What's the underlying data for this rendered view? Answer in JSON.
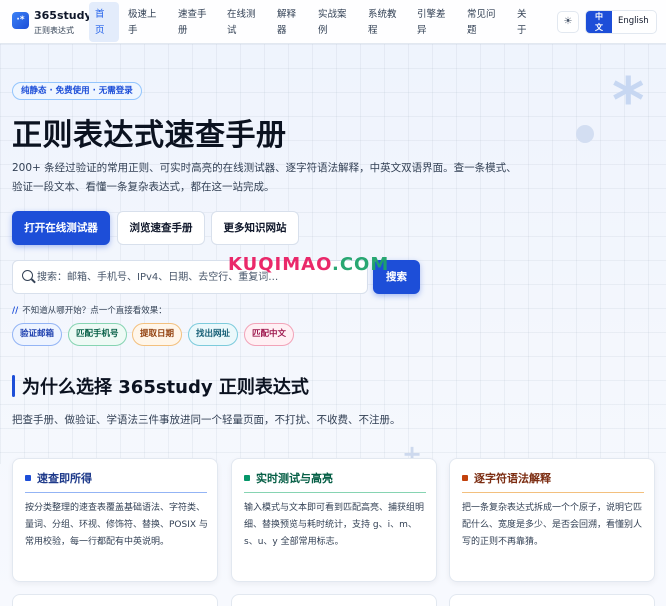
{
  "brand": {
    "name": "365study",
    "subtitle": "正则表达式",
    "logo_glyph": "·*"
  },
  "nav": {
    "items": [
      "首页",
      "极速上手",
      "速查手册",
      "在线测试",
      "解释器",
      "实战案例",
      "系统教程",
      "引擎差异",
      "常见问题",
      "关于"
    ],
    "active_index": 0
  },
  "theme_toggle": {
    "icon": "sun-icon",
    "glyph": "☀"
  },
  "lang": {
    "zh": "中文",
    "en": "English",
    "active": "zh"
  },
  "hero": {
    "badge": "纯静态 · 免费使用 · 无需登录",
    "title": "正则表达式速查手册",
    "description": "200+ 条经过验证的常用正则、可实时高亮的在线测试器、逐字符语法解释，中英文双语界面。查一条模式、验证一段文本、看懂一条复杂表达式，都在这一站完成。",
    "primary_button": "打开在线测试器",
    "secondary_button": "浏览速查手册",
    "tertiary_button": "更多知识网站"
  },
  "search": {
    "placeholder": "搜索：邮箱、手机号、IPv4、日期、去空行、重复词…",
    "button": "搜索"
  },
  "hint": {
    "prefix": "//",
    "text": "不知道从哪开始？点一个直接看效果："
  },
  "quick_chips": [
    "验证邮箱",
    "匹配手机号",
    "提取日期",
    "找出网址",
    "匹配中文"
  ],
  "watermark": {
    "left": "KUQIMAO",
    "dot": ".",
    "right": "COM"
  },
  "why": {
    "title": "为什么选择 365study 正则表达式",
    "description": "把查手册、做验证、学语法三件事放进同一个轻量页面，不打扰、不收费、不注册。"
  },
  "features": [
    {
      "title": "速查即所得",
      "text": "按分类整理的速查表覆盖基础语法、字符类、量词、分组、环视、修饰符、替换、POSIX 与常用校验，每一行都配有中英说明。"
    },
    {
      "title": "实时测试与高亮",
      "text": "输入模式与文本即可看到匹配高亮、捕获组明细、替换预览与耗时统计，支持 g、i、m、s、u、y 全部常用标志。"
    },
    {
      "title": "逐字符语法解释",
      "text": "把一条复杂表达式拆成一个个原子，说明它匹配什么、宽度是多少、是否会回溯，看懂别人写的正则不再靠猜。"
    }
  ],
  "colors": {
    "accent": "#1d4ed8",
    "card1": "#1d4ed8",
    "card2": "#059669",
    "card3": "#c2410c"
  }
}
